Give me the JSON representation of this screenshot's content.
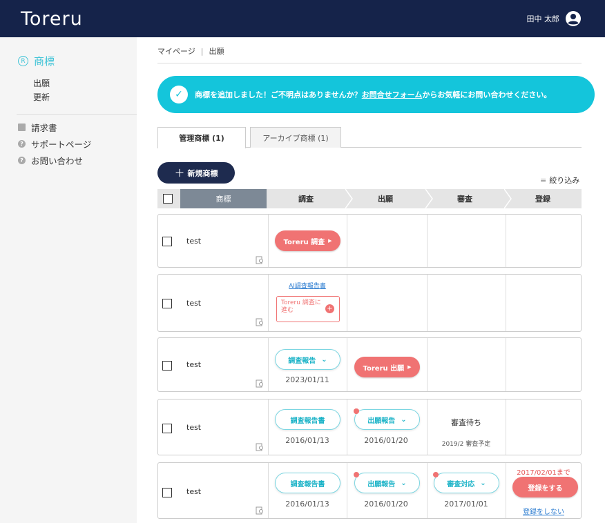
{
  "header": {
    "logo": "Toreru",
    "user_name": "田中 太郎"
  },
  "sidebar": {
    "brand": "商標",
    "sub_items": [
      "出願",
      "更新"
    ],
    "links": [
      {
        "label": "請求書",
        "icon": "document-icon"
      },
      {
        "label": "サポートページ",
        "icon": "help-icon"
      },
      {
        "label": "お問い合わせ",
        "icon": "help-icon"
      }
    ]
  },
  "breadcrumb": {
    "home": "マイページ",
    "separator": "|",
    "current": "出願"
  },
  "notice": {
    "before": "商標を追加しました！ご不明点はありませんか？",
    "link": "お問合せフォーム",
    "after": "からお気軽にお問い合わせください。"
  },
  "tabs": {
    "active": "管理商標 (1)",
    "archive": "アーカイブ商標 (1)"
  },
  "actions": {
    "new_mark": "新規商標",
    "filter": "絞り込み"
  },
  "table": {
    "headers": {
      "mark": "商標",
      "survey": "調査",
      "application": "出願",
      "examination": "審査",
      "registration": "登録"
    },
    "rows": [
      {
        "name": "test",
        "survey_button": "Toreru 調査"
      },
      {
        "name": "test",
        "survey_link": "AI調査報告書",
        "survey_box_line1": "Toreru 調査に",
        "survey_box_line2": "進む"
      },
      {
        "name": "test",
        "survey_report": "調査報告",
        "survey_date": "2023/01/11",
        "application_button": "Toreru 出願"
      },
      {
        "name": "test",
        "survey_report": "調査報告書",
        "survey_date": "2016/01/13",
        "application_report": "出願報告",
        "application_date": "2016/01/20",
        "examination_status": "審査待ち",
        "examination_note": "2019/2 審査予定"
      },
      {
        "name": "test",
        "survey_report": "調査報告書",
        "survey_date": "2016/01/13",
        "application_report": "出願報告",
        "application_date": "2016/01/20",
        "examination_report": "審査対応",
        "examination_date": "2017/01/01",
        "registration_deadline": "2017/02/01まで",
        "registration_button": "登録をする",
        "registration_decline": "登録をしない"
      }
    ]
  },
  "colors": {
    "header_bg": "#15234a",
    "accent_teal": "#14c5db",
    "accent_red": "#f07373",
    "navy_button": "#1e2b4f"
  }
}
